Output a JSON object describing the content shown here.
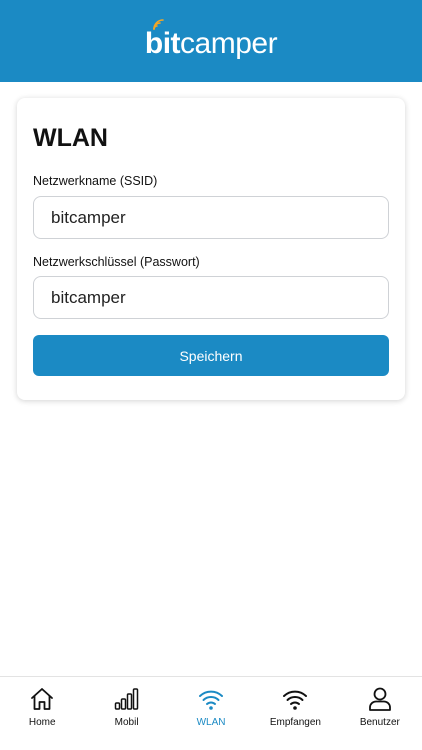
{
  "header": {
    "logo_bit": "bit",
    "logo_camper": "camper"
  },
  "card": {
    "title": "WLAN",
    "ssid_label": "Netzwerkname (SSID)",
    "ssid_value": "bitcamper",
    "password_label": "Netzwerkschlüssel (Passwort)",
    "password_value": "bitcamper",
    "save_label": "Speichern"
  },
  "tabbar": {
    "items": [
      {
        "label": "Home",
        "icon": "home-icon",
        "active": false
      },
      {
        "label": "Mobil",
        "icon": "signal-bars-icon",
        "active": false
      },
      {
        "label": "WLAN",
        "icon": "wifi-icon",
        "active": true
      },
      {
        "label": "Empfangen",
        "icon": "wifi-icon",
        "active": false
      },
      {
        "label": "Benutzer",
        "icon": "user-icon",
        "active": false
      }
    ]
  },
  "colors": {
    "brand": "#1b8ac4",
    "logo_accent": "#f5a623"
  }
}
